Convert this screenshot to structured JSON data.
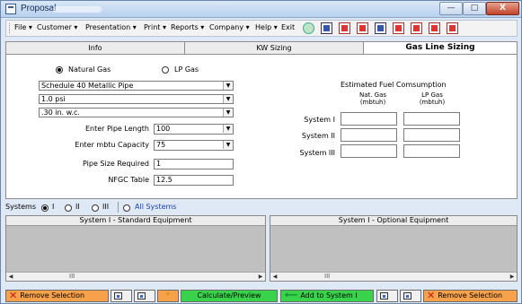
{
  "window": {
    "title": "Proposal"
  },
  "menu": {
    "items": [
      "File ▾",
      "Customer ▾",
      "Presentation ▾",
      "Print ▾",
      "Reports ▾",
      "Company ▾",
      "Help ▾",
      "Exit"
    ]
  },
  "tabs": [
    "Info",
    "KW Sizing",
    "Gas Line Sizing"
  ],
  "gas_line": {
    "fuel_natural": "Natural Gas",
    "fuel_lp": "LP Gas",
    "pipe_type": "Schedule 40 Metallic Pipe",
    "pressure": "1.0 psi",
    "drop": ".30 in. w.c.",
    "pipe_length_label": "Enter Pipe Length",
    "pipe_length": "100",
    "mbtu_label": "Enter mbtu Capacity",
    "mbtu": "75",
    "pipe_size_label": "Pipe Size Required",
    "pipe_size": "1",
    "nfgc_label": "NFGC Table",
    "nfgc": "12.5"
  },
  "consumption": {
    "title": "Estimated Fuel Comsumption",
    "col_nat_line1": "Nat. Gas",
    "col_nat_line2": "(mbtuh)",
    "col_lp_line1": "LP Gas",
    "col_lp_line2": "(mbtuh)",
    "rows": [
      "System I",
      "System II",
      "System III"
    ]
  },
  "systems": {
    "label": "Systems",
    "opt1": "I",
    "opt2": "II",
    "opt3": "III",
    "all": "All Systems"
  },
  "lists": {
    "standard_title": "System I - Standard Equipment",
    "optional_title": "System I - Optional Equipment",
    "scroll_dots": "III"
  },
  "bottom": {
    "remove_selection_left": "Remove Selection",
    "calculate": "Calculate/Preview",
    "add_to_system": "Add to System I",
    "remove_selection_right": "Remove Selection",
    "star": "*"
  },
  "icons": {
    "app": "proposal-window-icon",
    "remove": "red-x-icon",
    "add": "green-arrow-icon"
  },
  "colors": {
    "orange": "#f7a14a",
    "green": "#38d34a",
    "red": "#c8161a"
  }
}
